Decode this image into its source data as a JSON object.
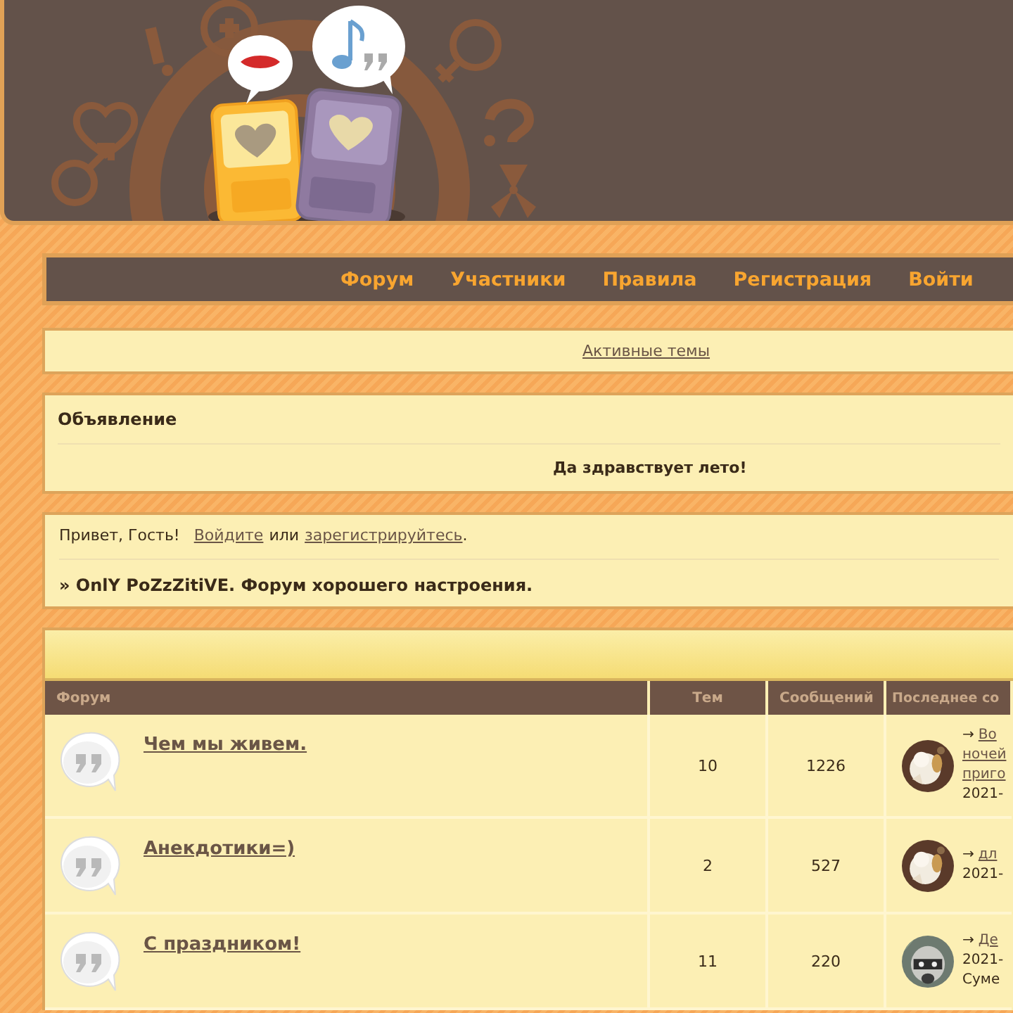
{
  "nav": [
    {
      "label": "Форум"
    },
    {
      "label": "Участники"
    },
    {
      "label": "Правила"
    },
    {
      "label": "Регистрация"
    },
    {
      "label": "Войти"
    }
  ],
  "active_topics_link": "Активные темы",
  "announcement": {
    "title": "Объявление",
    "text": "Да здравствует лето!"
  },
  "welcome": {
    "greeting": "Привет, Гость!",
    "login_link": "Войдите",
    "or": "или",
    "register_link": "зарегистрируйтесь",
    "period": ".",
    "board_title": "» OnlY PoZzZitiVE. Форум хорошего настроения."
  },
  "table": {
    "columns": [
      "Форум",
      "Тем",
      "Сообщений",
      "Последнее со"
    ],
    "rows": [
      {
        "title": "Чем мы живем.",
        "topics": "10",
        "posts": "1226",
        "arrow": "→",
        "last_lines": [
          "Во",
          "ночей",
          "приго"
        ],
        "meta_lines": [
          "2021-"
        ]
      },
      {
        "title": "Анекдотики=)",
        "topics": "2",
        "posts": "527",
        "arrow": "→",
        "last_lines": [
          "дл"
        ],
        "meta_lines": [
          "2021-"
        ]
      },
      {
        "title": "С праздником!",
        "topics": "11",
        "posts": "220",
        "arrow": "→",
        "last_lines": [
          "Де"
        ],
        "meta_lines": [
          "2021-",
          "Суме"
        ]
      }
    ]
  }
}
